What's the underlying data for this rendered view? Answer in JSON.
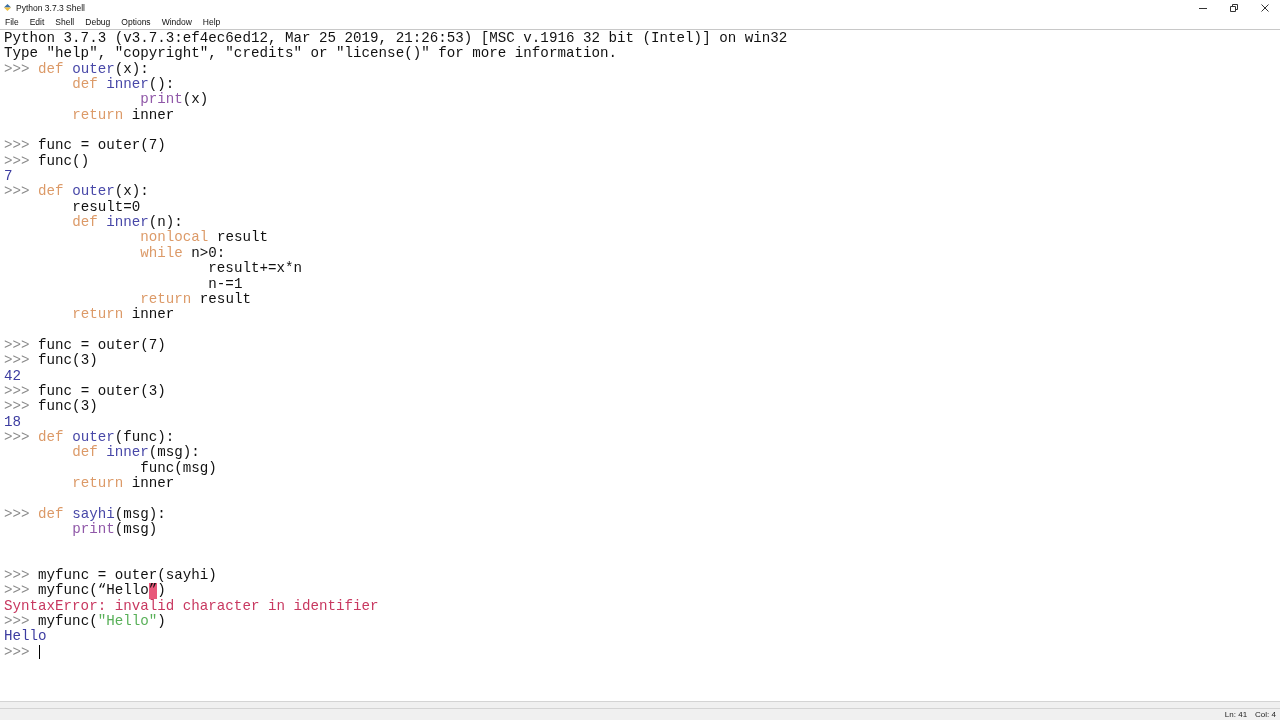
{
  "window": {
    "title": "Python 3.7.3 Shell"
  },
  "menu": [
    "File",
    "Edit",
    "Shell",
    "Debug",
    "Options",
    "Window",
    "Help"
  ],
  "lines": [
    {
      "cursor": false,
      "tokens": [
        {
          "kind": "plain",
          "text": "Python 3.7.3 (v3.7.3:ef4ec6ed12, Mar 25 2019, 21:26:53) [MSC v.1916 32 bit (Intel)] on win32"
        }
      ]
    },
    {
      "cursor": false,
      "tokens": [
        {
          "kind": "plain",
          "text": "Type \"help\", \"copyright\", \"credits\" or \"license()\" for more information."
        }
      ]
    },
    {
      "cursor": false,
      "tokens": [
        {
          "kind": "prompt",
          "text": ">>> "
        },
        {
          "kind": "keyword",
          "text": "def "
        },
        {
          "kind": "name",
          "text": "outer"
        },
        {
          "kind": "plain",
          "text": "(x):"
        }
      ]
    },
    {
      "cursor": false,
      "tokens": [
        {
          "kind": "keyword",
          "text": "\tdef "
        },
        {
          "kind": "name",
          "text": "inner"
        },
        {
          "kind": "plain",
          "text": "():"
        }
      ]
    },
    {
      "cursor": false,
      "tokens": [
        {
          "kind": "builtin",
          "text": "\t\tprint"
        },
        {
          "kind": "plain",
          "text": "(x)"
        }
      ]
    },
    {
      "cursor": false,
      "tokens": [
        {
          "kind": "keyword",
          "text": "\treturn "
        },
        {
          "kind": "plain",
          "text": "inner"
        }
      ]
    },
    {
      "cursor": false
    },
    {
      "cursor": false,
      "tokens": [
        {
          "kind": "prompt",
          "text": ">>> "
        },
        {
          "kind": "plain",
          "text": "func = outer(7)"
        }
      ]
    },
    {
      "cursor": false,
      "tokens": [
        {
          "kind": "prompt",
          "text": ">>> "
        },
        {
          "kind": "plain",
          "text": "func()"
        }
      ]
    },
    {
      "cursor": false,
      "tokens": [
        {
          "kind": "output",
          "text": "7"
        }
      ]
    },
    {
      "cursor": false,
      "tokens": [
        {
          "kind": "prompt",
          "text": ">>> "
        },
        {
          "kind": "keyword",
          "text": "def "
        },
        {
          "kind": "name",
          "text": "outer"
        },
        {
          "kind": "plain",
          "text": "(x):"
        }
      ]
    },
    {
      "cursor": false,
      "tokens": [
        {
          "kind": "plain",
          "text": "\tresult=0"
        }
      ]
    },
    {
      "cursor": false,
      "tokens": [
        {
          "kind": "keyword",
          "text": "\tdef "
        },
        {
          "kind": "name",
          "text": "inner"
        },
        {
          "kind": "plain",
          "text": "(n):"
        }
      ]
    },
    {
      "cursor": false,
      "tokens": [
        {
          "kind": "keyword",
          "text": "\t\tnonlocal "
        },
        {
          "kind": "plain",
          "text": "result"
        }
      ]
    },
    {
      "cursor": false,
      "tokens": [
        {
          "kind": "keyword",
          "text": "\t\twhile "
        },
        {
          "kind": "plain",
          "text": "n>0:"
        }
      ]
    },
    {
      "cursor": false,
      "tokens": [
        {
          "kind": "plain",
          "text": "\t\t\tresult+=x*n"
        }
      ]
    },
    {
      "cursor": false,
      "tokens": [
        {
          "kind": "plain",
          "text": "\t\t\tn-=1"
        }
      ]
    },
    {
      "cursor": false,
      "tokens": [
        {
          "kind": "keyword",
          "text": "\t\treturn "
        },
        {
          "kind": "plain",
          "text": "result"
        }
      ]
    },
    {
      "cursor": false,
      "tokens": [
        {
          "kind": "keyword",
          "text": "\treturn "
        },
        {
          "kind": "plain",
          "text": "inner"
        }
      ]
    },
    {
      "cursor": false
    },
    {
      "cursor": false,
      "tokens": [
        {
          "kind": "prompt",
          "text": ">>> "
        },
        {
          "kind": "plain",
          "text": "func = outer(7)"
        }
      ]
    },
    {
      "cursor": false,
      "tokens": [
        {
          "kind": "prompt",
          "text": ">>> "
        },
        {
          "kind": "plain",
          "text": "func(3)"
        }
      ]
    },
    {
      "cursor": false,
      "tokens": [
        {
          "kind": "output",
          "text": "42"
        }
      ]
    },
    {
      "cursor": false,
      "tokens": [
        {
          "kind": "prompt",
          "text": ">>> "
        },
        {
          "kind": "plain",
          "text": "func = outer(3)"
        }
      ]
    },
    {
      "cursor": false,
      "tokens": [
        {
          "kind": "prompt",
          "text": ">>> "
        },
        {
          "kind": "plain",
          "text": "func(3)"
        }
      ]
    },
    {
      "cursor": false,
      "tokens": [
        {
          "kind": "output",
          "text": "18"
        }
      ]
    },
    {
      "cursor": false,
      "tokens": [
        {
          "kind": "prompt",
          "text": ">>> "
        },
        {
          "kind": "keyword",
          "text": "def "
        },
        {
          "kind": "name",
          "text": "outer"
        },
        {
          "kind": "plain",
          "text": "(func):"
        }
      ]
    },
    {
      "cursor": false,
      "tokens": [
        {
          "kind": "keyword",
          "text": "\tdef "
        },
        {
          "kind": "name",
          "text": "inner"
        },
        {
          "kind": "plain",
          "text": "(msg):"
        }
      ]
    },
    {
      "cursor": false,
      "tokens": [
        {
          "kind": "plain",
          "text": "\t\tfunc(msg)"
        }
      ]
    },
    {
      "cursor": false,
      "tokens": [
        {
          "kind": "keyword",
          "text": "\treturn "
        },
        {
          "kind": "plain",
          "text": "inner"
        }
      ]
    },
    {
      "cursor": false
    },
    {
      "cursor": false,
      "tokens": [
        {
          "kind": "prompt",
          "text": ">>> "
        },
        {
          "kind": "keyword",
          "text": "def "
        },
        {
          "kind": "name",
          "text": "sayhi"
        },
        {
          "kind": "plain",
          "text": "(msg):"
        }
      ]
    },
    {
      "cursor": false,
      "tokens": [
        {
          "kind": "builtin",
          "text": "\tprint"
        },
        {
          "kind": "plain",
          "text": "(msg)"
        }
      ]
    },
    {
      "cursor": false
    },
    {
      "cursor": false
    },
    {
      "cursor": false,
      "tokens": [
        {
          "kind": "prompt",
          "text": ">>> "
        },
        {
          "kind": "plain",
          "text": "myfunc = outer(sayhi)"
        }
      ]
    },
    {
      "cursor": false,
      "tokens": [
        {
          "kind": "prompt",
          "text": ">>> "
        },
        {
          "kind": "plain",
          "text": "myfunc(“Hello"
        },
        {
          "kind": "errmark",
          "text": "”"
        },
        {
          "kind": "plain",
          "text": ")"
        }
      ]
    },
    {
      "cursor": false,
      "tokens": [
        {
          "kind": "error",
          "text": "SyntaxError: invalid character in identifier"
        }
      ]
    },
    {
      "cursor": false,
      "tokens": [
        {
          "kind": "prompt",
          "text": ">>> "
        },
        {
          "kind": "plain",
          "text": "myfunc("
        },
        {
          "kind": "string",
          "text": "\"Hello\""
        },
        {
          "kind": "plain",
          "text": ")"
        }
      ]
    },
    {
      "cursor": false,
      "tokens": [
        {
          "kind": "output",
          "text": "Hello"
        }
      ]
    },
    {
      "cursor": true,
      "tokens": [
        {
          "kind": "prompt",
          "text": ">>> "
        }
      ]
    }
  ],
  "status_bar": {
    "line": "Ln: 41",
    "column": "Col: 4"
  }
}
